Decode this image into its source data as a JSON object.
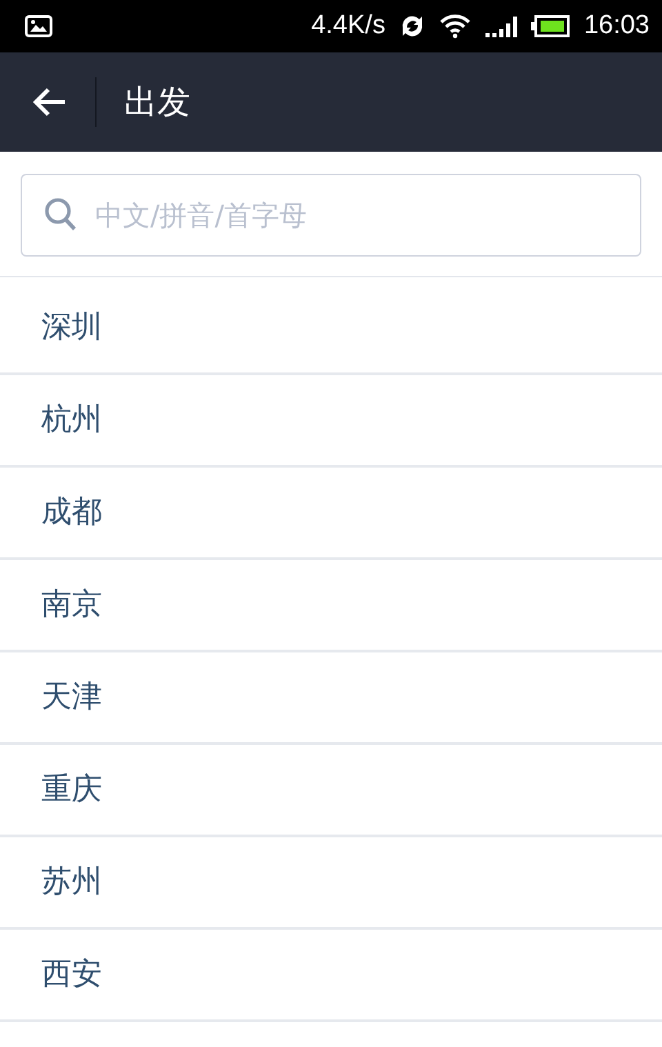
{
  "status_bar": {
    "speed": "4.4K/s",
    "time": "16:03"
  },
  "header": {
    "title": "出发"
  },
  "search": {
    "placeholder": "中文/拼音/首字母"
  },
  "cities": [
    "深圳",
    "杭州",
    "成都",
    "南京",
    "天津",
    "重庆",
    "苏州",
    "西安"
  ]
}
